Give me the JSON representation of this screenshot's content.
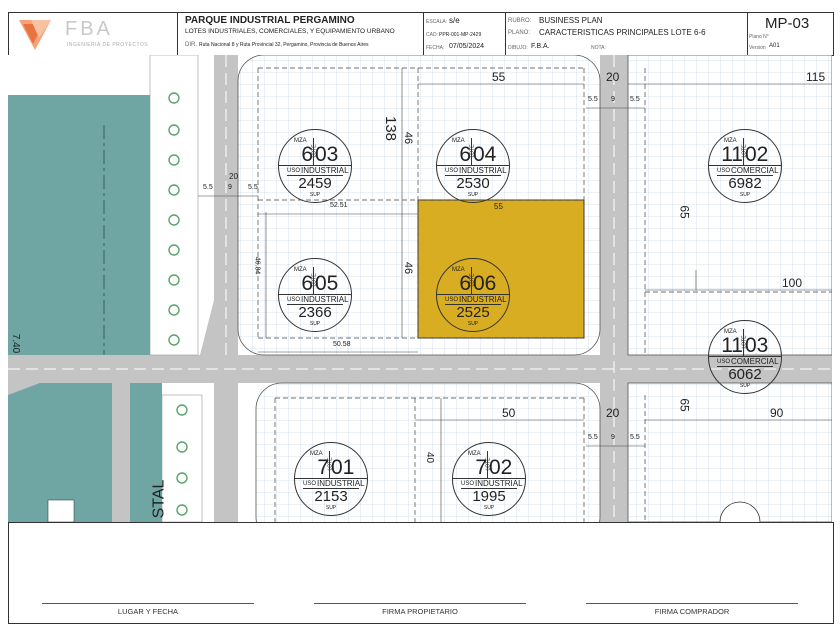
{
  "titleblock": {
    "logo_text": "FBA",
    "logo_subtitle": "INGENIERIA DE PROYECTOS",
    "project_title": "PARQUE INDUSTRIAL PERGAMINO",
    "project_subtitle": "LOTES INDUSTRIALES, COMERCIALES, Y EQUIPAMIENTO URBANO",
    "dir_label": "DIR.",
    "dir_value": "Ruta Nacional 8 y Ruta Provincial 32, Pergamino, Provincia de Buenos Aires",
    "escala_label": "ESCALA:",
    "escala_value": "s/e",
    "cad_label": "CAD:",
    "cad_value": "PPR-001-MP-2429",
    "fecha_label": "FECHA:",
    "fecha_value": "07/05/2024",
    "rubro_label": "RUBRO:",
    "rubro_value": "BUSINESS PLAN",
    "plano_label": "PLANO:",
    "plano_value": "CARACTERISTICAS PRINCIPALES LOTE 6-6",
    "dibujo_label": "DIBUJO:",
    "dibujo_value": "F.B.A.",
    "nota_label": "NOTA:",
    "sheet_code": "MP-03",
    "plano_n_label": "Plano N°",
    "version_label": "Version",
    "version_value": "A01"
  },
  "lots": [
    {
      "mza": "6",
      "lote": "03",
      "uso": "INDUSTRIAL",
      "sup": "2459",
      "highlight": false
    },
    {
      "mza": "6",
      "lote": "04",
      "uso": "INDUSTRIAL",
      "sup": "2530",
      "highlight": false
    },
    {
      "mza": "6",
      "lote": "05",
      "uso": "INDUSTRIAL",
      "sup": "2366",
      "highlight": false
    },
    {
      "mza": "6",
      "lote": "06",
      "uso": "INDUSTRIAL",
      "sup": "2525",
      "highlight": true
    },
    {
      "mza": "11",
      "lote": "02",
      "uso": "COMERCIAL",
      "sup": "6982",
      "highlight": false
    },
    {
      "mza": "11",
      "lote": "03",
      "uso": "COMERCIAL",
      "sup": "6062",
      "highlight": false
    },
    {
      "mza": "7",
      "lote": "01",
      "uso": "INDUSTRIAL",
      "sup": "2153",
      "highlight": false
    },
    {
      "mza": "7",
      "lote": "02",
      "uso": "INDUSTRIAL",
      "sup": "1995",
      "highlight": false
    }
  ],
  "lot_labels": {
    "mza": "MZA",
    "lote": "LOTE",
    "uso": "USO",
    "sup": "SUP"
  },
  "dimensions": [
    "55",
    "138",
    "46",
    "20",
    "115",
    "5.5",
    "9",
    "5.5",
    "20",
    "5.5",
    "9",
    "5.5",
    "52.51",
    "55",
    "65",
    "46",
    "46.84",
    "100",
    "50.58",
    "7.40",
    "65",
    "90",
    "50",
    "20",
    "5.5",
    "9",
    "5.5",
    "40"
  ],
  "street_text": "STAL",
  "signatures": [
    "LUGAR Y FECHA",
    "FIRMA PROPIETARIO",
    "FIRMA COMPRADOR"
  ],
  "colors": {
    "road": "#c4c4c4",
    "green_area": "#6fa5a3",
    "highlight_lot": "#d9ad22",
    "lot_fill": "#ffffff",
    "grid": "#b8cde0"
  }
}
